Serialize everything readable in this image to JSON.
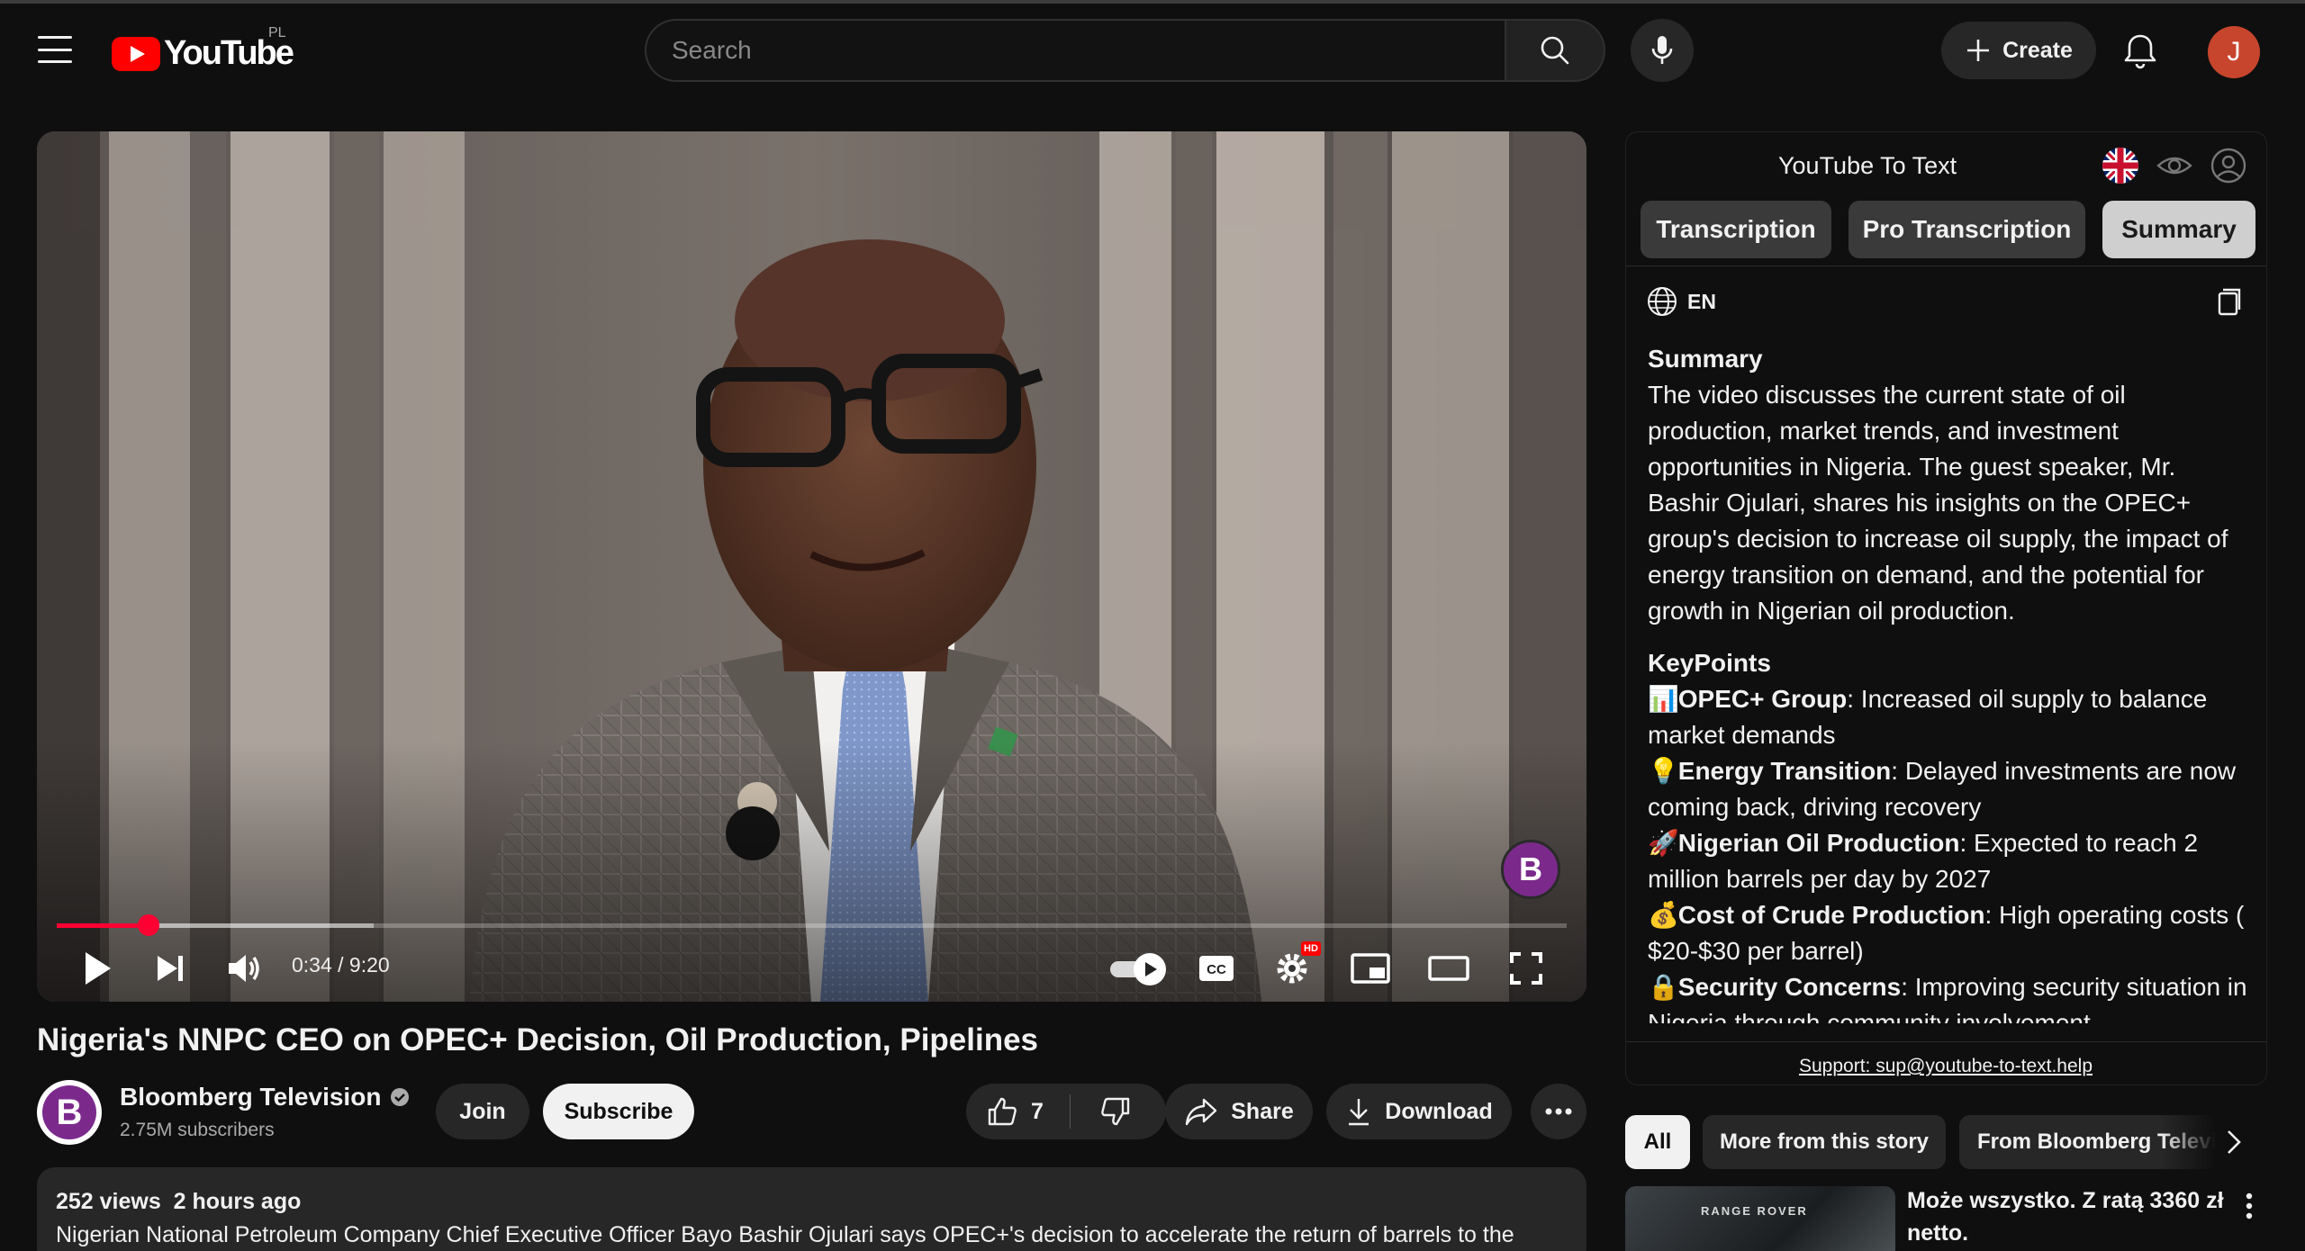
{
  "header": {
    "logo_text": "YouTube",
    "country_code": "PL",
    "search_placeholder": "Search",
    "create_label": "Create",
    "avatar_initial": "J"
  },
  "player": {
    "time_current": "0:34",
    "time_total": "9:20",
    "time_display": "0:34 / 9:20",
    "progress_fraction": 0.061,
    "buffered_fraction": 0.21,
    "settings_badge": "HD",
    "watermark_initial": "B"
  },
  "video": {
    "title": "Nigeria's NNPC CEO on OPEC+ Decision, Oil Production, Pipelines",
    "channel_name": "Bloomberg Television",
    "channel_initial": "B",
    "subscribers": "2.75M subscribers",
    "join_label": "Join",
    "subscribe_label": "Subscribe",
    "likes": "7",
    "share_label": "Share",
    "download_label": "Download",
    "views": "252 views",
    "posted": "2 hours ago",
    "description": "Nigerian National Petroleum Company Chief Executive Officer Bayo Bashir Ojulari says OPEC+'s decision to accelerate the return of barrels to the"
  },
  "ytt": {
    "title": "YouTube To Text",
    "tabs": [
      "Transcription",
      "Pro Transcription",
      "Summary"
    ],
    "active_tab": "Summary",
    "language": "EN",
    "summary_heading": "Summary",
    "summary_text": "The video discusses the current state of oil production, market trends, and investment opportunities in Nigeria. The guest speaker, Mr. Bashir Ojulari, shares his insights on the OPEC+ group's decision to increase oil supply, the impact of energy transition on demand, and the potential for growth in Nigerian oil production.",
    "keypoints_heading": "KeyPoints",
    "keypoints": [
      {
        "emoji": "📊",
        "title": "OPEC+ Group",
        "text": ": Increased oil supply to balance market demands"
      },
      {
        "emoji": "💡",
        "title": "Energy Transition",
        "text": ": Delayed investments are now coming back, driving recovery"
      },
      {
        "emoji": "🚀",
        "title": "Nigerian Oil Production",
        "text": ": Expected to reach 2 million barrels per day by 2027"
      },
      {
        "emoji": "💰",
        "title": "Cost of Crude Production",
        "text": ": High operating costs ( $20-$30 per barrel)"
      },
      {
        "emoji": "🔒",
        "title": "Security Concerns",
        "text": ": Improving security situation in Nigeria through community involvement"
      }
    ],
    "support_text": "Support: sup@youtube-to-text.help"
  },
  "chips": [
    "All",
    "More from this story",
    "From Bloomberg Television"
  ],
  "recommendation": {
    "thumb_label": "RANGE ROVER",
    "title": "Może wszystko. Z ratą 3360 zł netto."
  },
  "colors": {
    "background": "#0f0f0f",
    "accent_red": "#ff0000",
    "progress_red": "#ff0033",
    "surface": "#272727",
    "active_tab": "#cfcfcf"
  }
}
